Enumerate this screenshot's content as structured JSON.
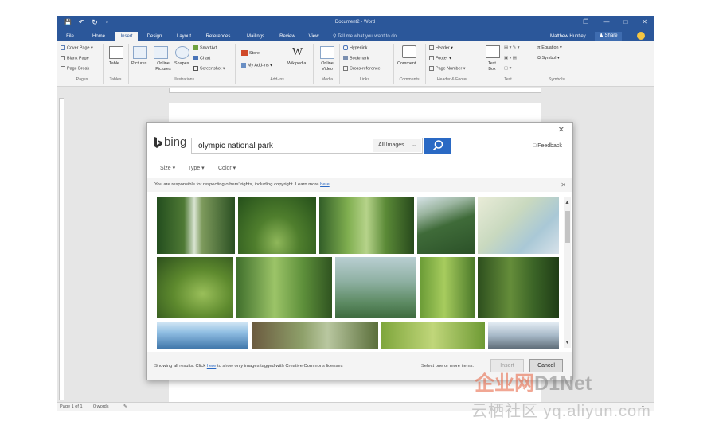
{
  "window": {
    "title": "Document2 - Word",
    "qat_save": "💾",
    "qat_undo": "↶",
    "qat_redo": "↻",
    "qat_more": "⌄",
    "min": "—",
    "max": "□",
    "close": "✕",
    "ribbon_opts": "❐"
  },
  "tabs": [
    "File",
    "Home",
    "Insert",
    "Design",
    "Layout",
    "References",
    "Mailings",
    "Review",
    "View"
  ],
  "active_tab": "Insert",
  "tell_me": "Tell me what you want to do...",
  "user": "Matthew Huntley",
  "share": "Share",
  "ribbon": {
    "pages": {
      "cover": "Cover Page",
      "blank": "Blank Page",
      "break": "Page Break",
      "group": "Pages"
    },
    "tables": {
      "table": "Table",
      "group": "Tables"
    },
    "illustrations": {
      "pictures": "Pictures",
      "online": "Online Pictures",
      "shapes": "Shapes",
      "smartart": "SmartArt",
      "chart": "Chart",
      "screenshot": "Screenshot",
      "group": "Illustrations"
    },
    "addins": {
      "store": "Store",
      "myaddins": "My Add-ins",
      "wikipedia": "Wikipedia",
      "group": "Add-ins"
    },
    "media": {
      "video": "Online Video",
      "group": "Media"
    },
    "links": {
      "hyperlink": "Hyperlink",
      "bookmark": "Bookmark",
      "crossref": "Cross-reference",
      "group": "Links"
    },
    "comments": {
      "comment": "Comment",
      "group": "Comments"
    },
    "headerfooter": {
      "header": "Header",
      "footer": "Footer",
      "pagenum": "Page Number",
      "group": "Header & Footer"
    },
    "text": {
      "textbox": "Text Box",
      "group": "Text"
    },
    "symbols": {
      "equation": "Equation",
      "symbol": "Symbol",
      "group": "Symbols"
    }
  },
  "status": {
    "page": "Page 1 of 1",
    "words": "0 words",
    "zoom": "+"
  },
  "dialog": {
    "brand": "bing",
    "query": "olympic national park",
    "scope": "All Images",
    "scope_caret": "⌄",
    "feedback": "Feedback",
    "close": "✕",
    "filters": {
      "size": "Size",
      "type": "Type",
      "color": "Color"
    },
    "notice_text": "You are responsible for respecting others' rights, including copyright. Learn more ",
    "notice_link": "here",
    "notice_end": ".",
    "notice_close": "✕",
    "footer_text_1": "Showing all results. Click ",
    "footer_link": "here",
    "footer_text_2": " to show only images tagged with Creative Commons licenses",
    "selection": "Select one or more items.",
    "insert": "Insert",
    "cancel": "Cancel",
    "scroll_up": "▲",
    "scroll_down": "▼"
  },
  "watermark": {
    "line1": "企业网",
    "line1b": "D1Net",
    "line2": "云栖社区 yq.aliyun.com"
  }
}
